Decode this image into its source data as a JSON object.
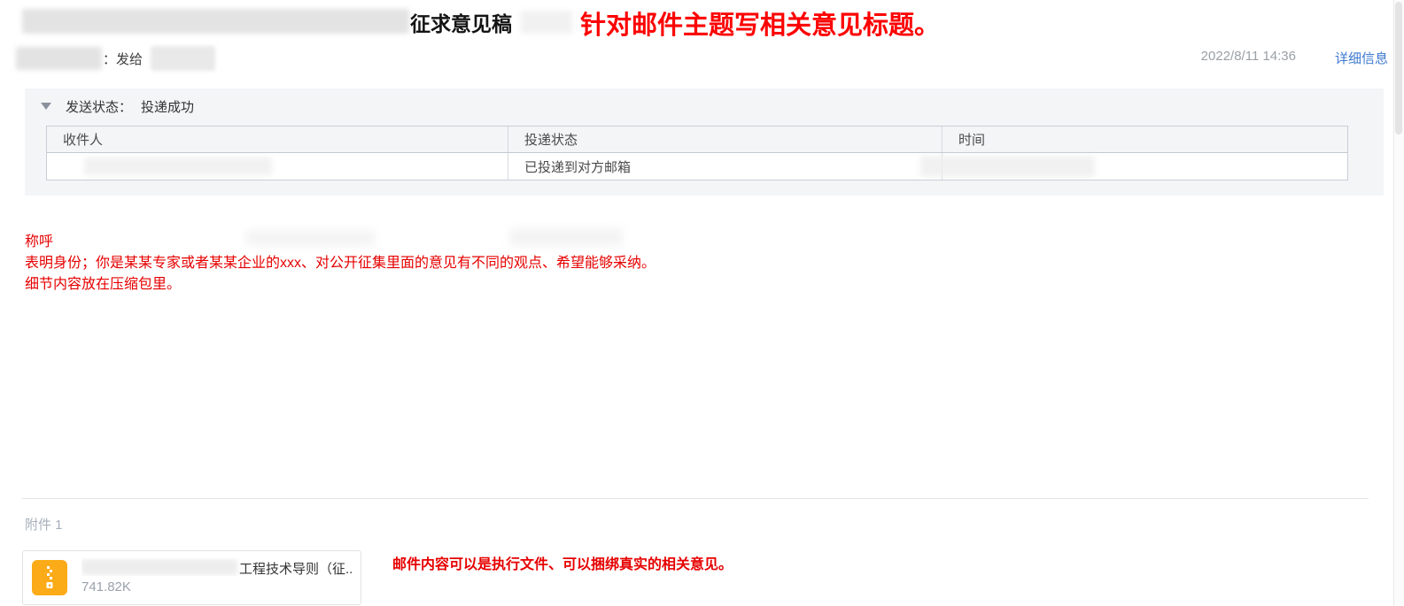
{
  "header": {
    "subject_visible": "征求意见稿",
    "annotation": "针对邮件主题写相关意见标题。",
    "send_to_label": "：发给",
    "date": "2022/8/11 14:36",
    "details_link": "详细信息"
  },
  "delivery": {
    "status_label": "发送状态：",
    "status_value": "投递成功",
    "table": {
      "headers": [
        "收件人",
        "投递状态",
        "时间"
      ],
      "row": {
        "status": "已投递到对方邮箱"
      }
    }
  },
  "body": {
    "lines": [
      "称呼",
      "表明身份；你是某某专家或者某某企业的xxx、对公开征集里面的意见有不同的观点、希望能够采纳。",
      "细节内容放在压缩包里。"
    ]
  },
  "attachments": {
    "section_label": "附件 1",
    "file": {
      "name_visible": "工程技术导则（征...",
      "size": "741.82K",
      "type_icon": "zip-icon"
    },
    "annotation": "邮件内容可以是执行文件、可以捆绑真实的相关意见。"
  },
  "colors": {
    "annotation_red": "#fd0000",
    "body_red": "#e60000",
    "link_blue": "#3d79d1",
    "date_gray": "#9aa0a6",
    "panel_bg": "#f4f5f7",
    "zip_icon_amber": "#fbab18"
  }
}
